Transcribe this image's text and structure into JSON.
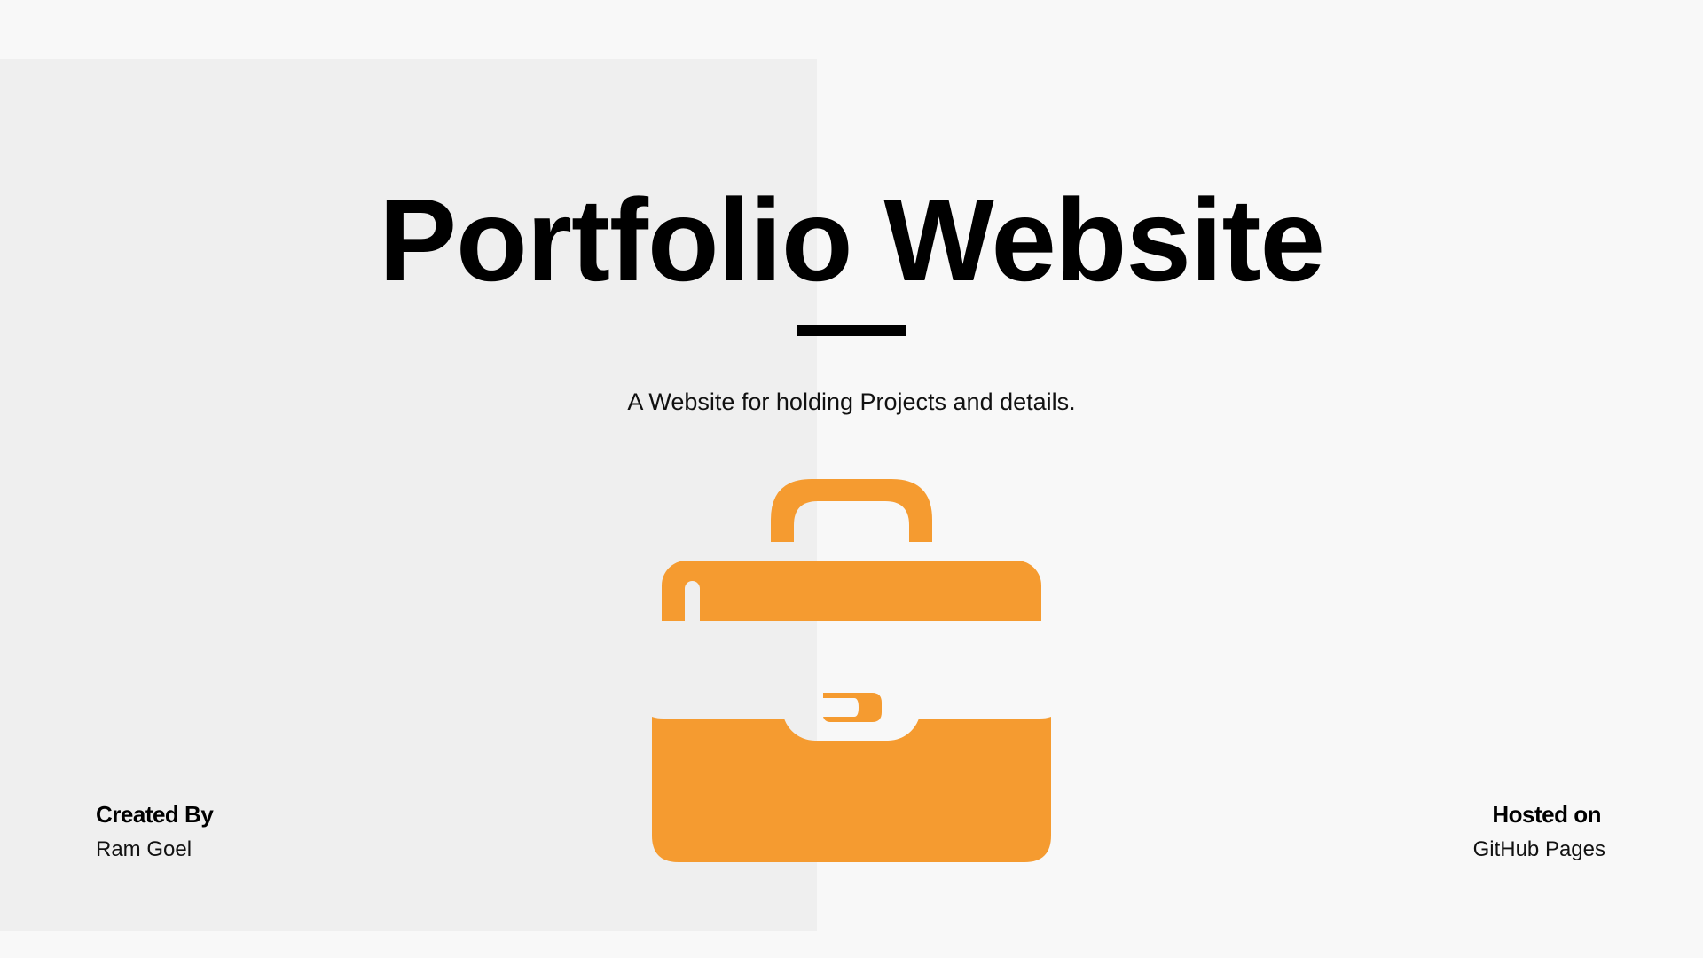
{
  "title": "Portfolio Website",
  "subtitle": "A Website for holding Projects and details.",
  "created": {
    "heading": "Created By",
    "value": "Ram Goel"
  },
  "hosted": {
    "heading": "Hosted on",
    "value": "GitHub Pages"
  },
  "icon": "briefcase-icon",
  "colors": {
    "accent": "#f59b30",
    "panel": "#efefef",
    "background": "#f8f8f8",
    "text": "#000000"
  }
}
